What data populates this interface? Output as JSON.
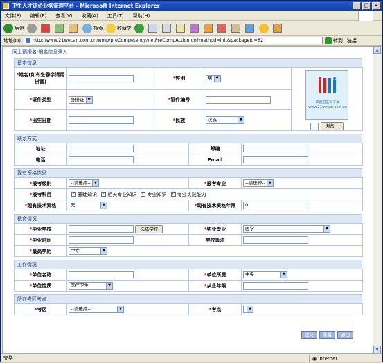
{
  "window": {
    "title": "卫生人才评价业务管理平台 - Microsoft Internet Explorer"
  },
  "menu": [
    "文件(F)",
    "编辑(E)",
    "查看(V)",
    "收藏(A)",
    "工具(T)",
    "帮助(H)"
  ],
  "toolbar": {
    "back": "后退",
    "search": "搜索",
    "favorites": "收藏夹"
  },
  "address": {
    "label": "地址(D)",
    "url": "http://www.21wecan.com.cn/wmp/preCompetency/netPreCompAction.do?method=init&packageId=82",
    "go": "转到",
    "links": "链接"
  },
  "breadcrumb": "网上预报名-报名信息录入",
  "basic": {
    "section": "基本信息",
    "name_label": "姓名(如有生僻字请用拼音)",
    "gender_label": "性别",
    "gender_value": "男",
    "id_type_label": "证件类型",
    "id_type_value": "身份证",
    "id_no_label": "证件编号",
    "birth_label": "出生日期",
    "ethnic_label": "民族",
    "ethnic_value": "汉族",
    "photo_caption1": "中国卫生人才网",
    "photo_caption2": "www.21wecan.com.cn",
    "browse": "浏览..."
  },
  "contact": {
    "section": "联系方式",
    "address_label": "地址",
    "postcode_label": "邮编",
    "phone_label": "电话",
    "email_label": "Email"
  },
  "qual": {
    "section": "现有资格信息",
    "level_label": "报考级别",
    "level_value": "--请选择--",
    "major_label": "报考专业",
    "major_value": "--请选择--",
    "subject_label": "报考科目",
    "subjects": [
      "基础知识",
      "相关专业知识",
      "专业知识",
      "专业实践能力"
    ],
    "tech_label": "现有技术资格",
    "tech_value": "无",
    "tech_years_label": "现有技术资格年限",
    "tech_years_value": "0"
  },
  "edu": {
    "section": "教育情况",
    "school_label": "毕业学校",
    "choose_school": "选择学校",
    "grad_major_label": "毕业专业",
    "grad_major_value": "医学",
    "grad_time_label": "毕业时间",
    "school_note_label": "学校备注",
    "degree_label": "最高学历",
    "degree_value": "中专"
  },
  "work": {
    "section": "工作情况",
    "unit_label": "单位名称",
    "belong_label": "单位所属",
    "belong_value": "中央",
    "nature_label": "单位性质",
    "nature_value": "医疗卫生",
    "years_label": "从业年限"
  },
  "exam": {
    "section": "所在考区考点",
    "area_label": "考区",
    "area_value": "--请选择--",
    "site_label": "考点"
  },
  "actions": {
    "submit": "提交",
    "reset": "重置",
    "back": "返回"
  },
  "status": {
    "left": "完毕",
    "zone": "Internet"
  }
}
